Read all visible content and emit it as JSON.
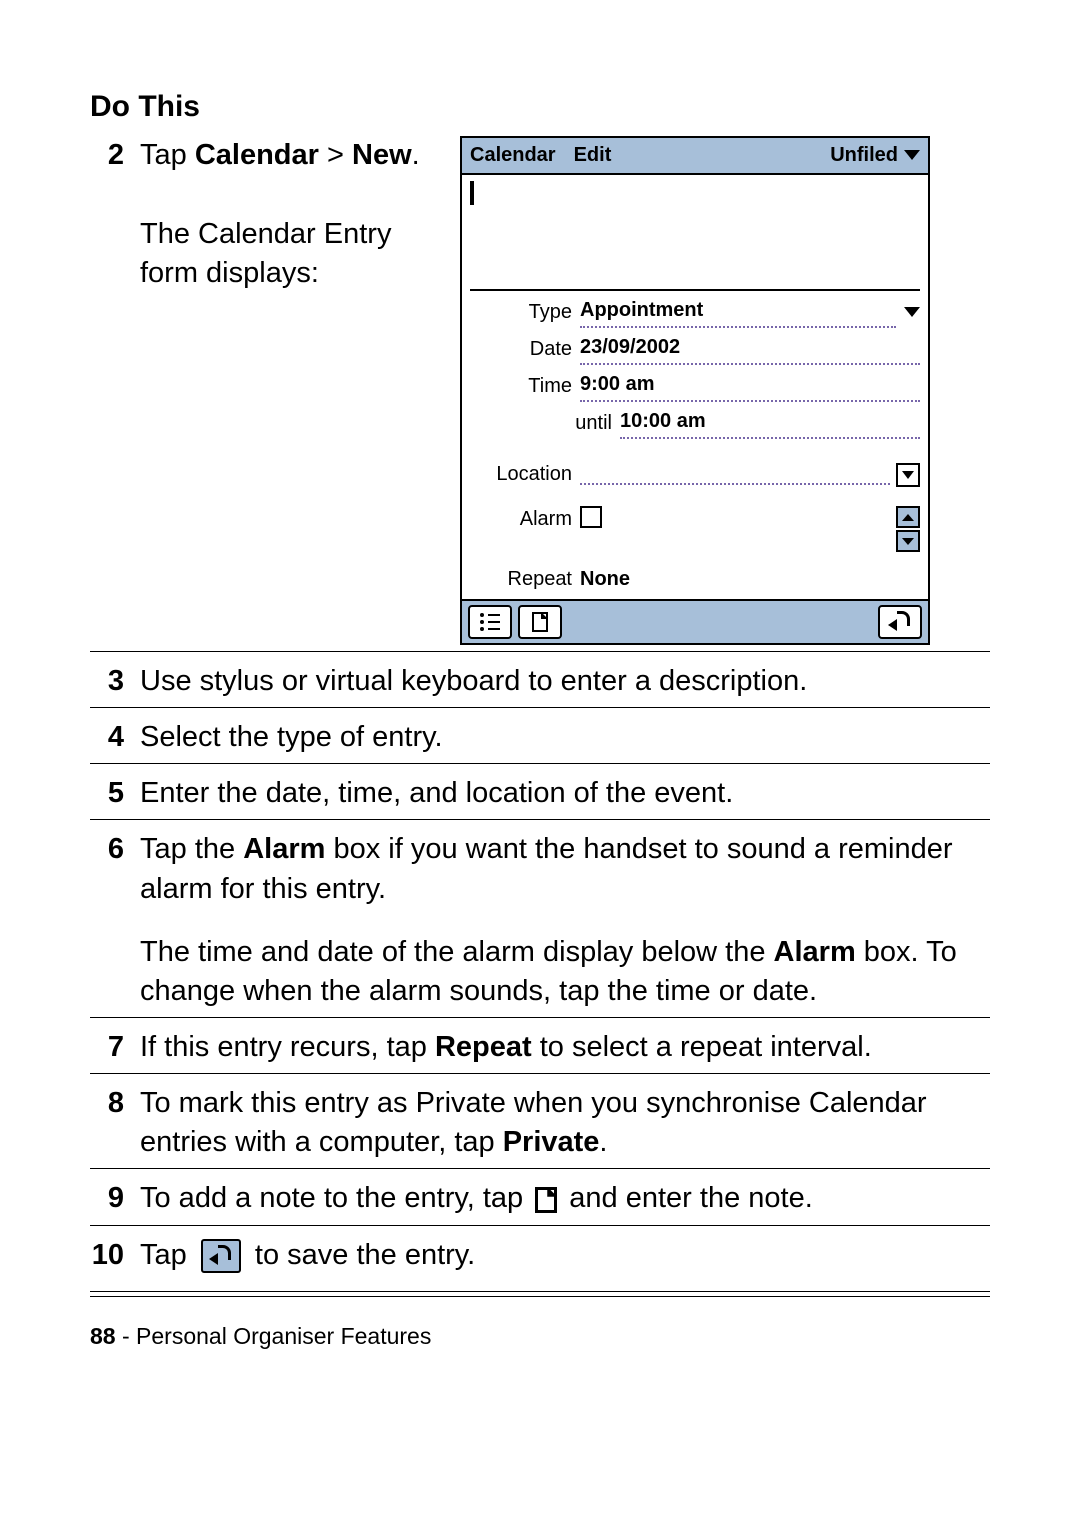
{
  "heading": "Do This",
  "steps": {
    "s2": {
      "num": "2",
      "tap": "Tap ",
      "calendar": "Calendar",
      "gt": " > ",
      "new": "New",
      "period": ".",
      "subtext": "The Calendar Entry form displays:"
    },
    "s3": {
      "num": "3",
      "text": "Use stylus or virtual keyboard to enter a description."
    },
    "s4": {
      "num": "4",
      "text": "Select the type of entry."
    },
    "s5": {
      "num": "5",
      "text": "Enter the date, time, and location of the event."
    },
    "s6": {
      "num": "6",
      "p1a": "Tap the ",
      "p1b": "Alarm",
      "p1c": " box if you want the handset to sound a reminder alarm for this entry.",
      "p2a": "The time and date of the alarm display below the ",
      "p2b": "Alarm",
      "p2c": " box. To change when the alarm sounds, tap the time or date."
    },
    "s7": {
      "num": "7",
      "a": "If this entry recurs, tap ",
      "b": "Repeat",
      "c": " to select a repeat interval."
    },
    "s8": {
      "num": "8",
      "a": "To mark this entry as Private when you synchronise Calendar entries with a computer, tap ",
      "b": "Private",
      "c": "."
    },
    "s9": {
      "num": "9",
      "a": "To add a note to the entry, tap ",
      "c": " and enter the note."
    },
    "s10": {
      "num": "10",
      "a": "Tap ",
      "c": " to save the entry."
    }
  },
  "phone": {
    "menubar": {
      "m1": "Calendar",
      "m2": "Edit",
      "folder": "Unfiled"
    },
    "labels": {
      "type": "Type",
      "date": "Date",
      "time": "Time",
      "until": "until",
      "location": "Location",
      "alarm": "Alarm",
      "repeat": "Repeat"
    },
    "values": {
      "type": "Appointment",
      "date": "23/09/2002",
      "time": "9:00 am",
      "until": "10:00 am",
      "repeat": "None"
    }
  },
  "footer": {
    "page": "88",
    "sep": " - ",
    "section": "Personal Organiser Features"
  }
}
